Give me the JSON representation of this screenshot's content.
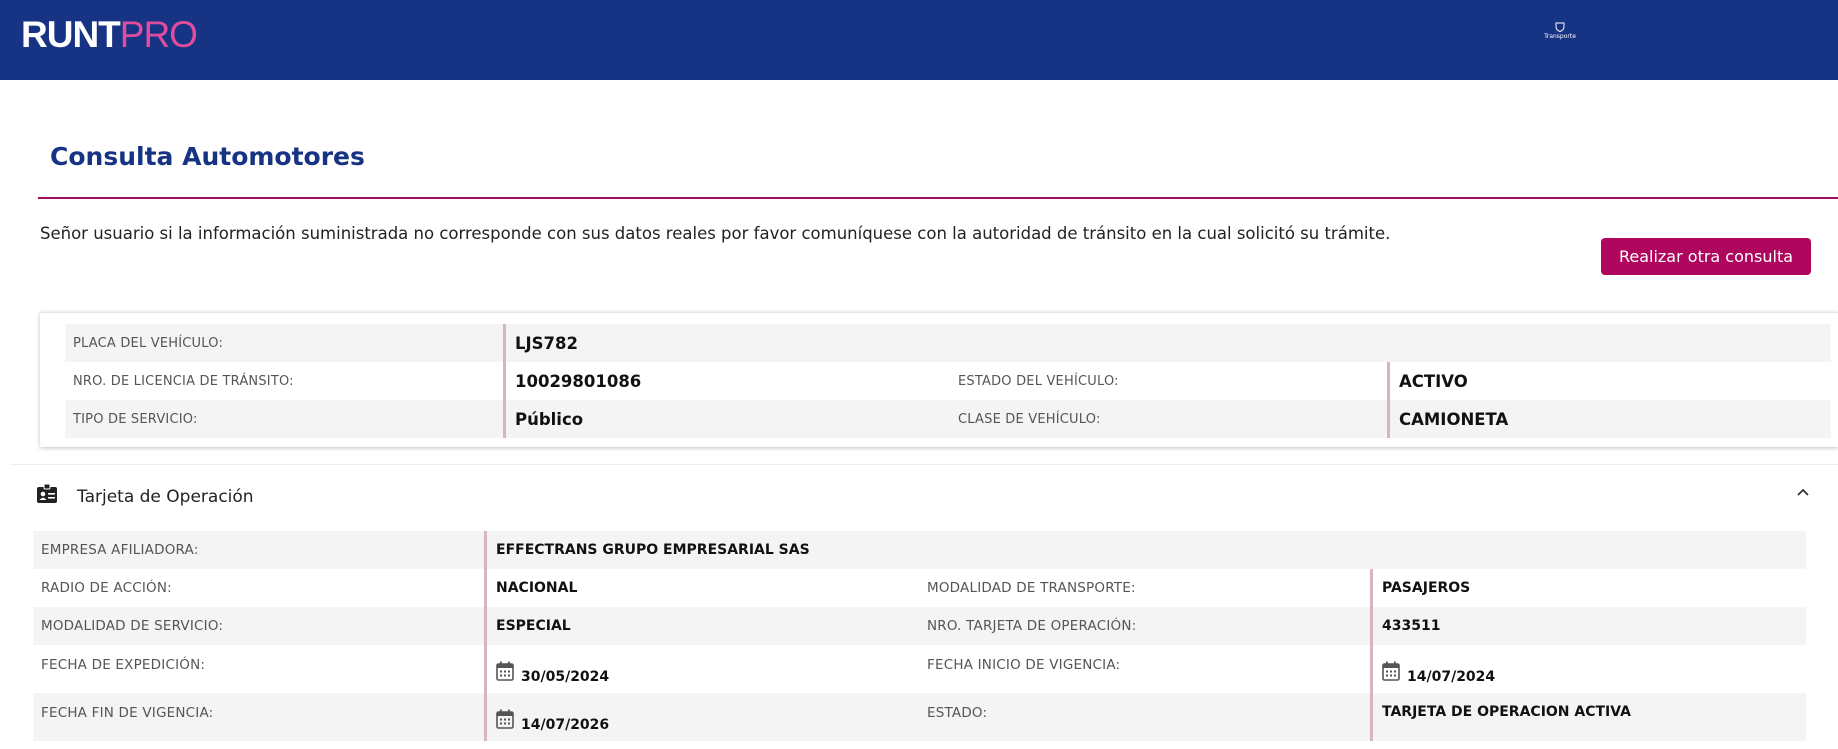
{
  "header": {
    "logo_runt": "RUNT",
    "logo_pro": "PRO",
    "ministry_label": "Transporte"
  },
  "page": {
    "title": "Consulta Automotores",
    "notice": "Señor usuario si la información suministrada no corresponde con sus datos reales por favor comuníquese con la autoridad de tránsito en la cual solicitó su trámite.",
    "new_query_button": "Realizar otra consulta"
  },
  "vehicle": {
    "plate_label": "PLACA DEL VEHÍCULO:",
    "plate_value": "LJS782",
    "license_label": "NRO. DE LICENCIA DE TRÁNSITO:",
    "license_value": "10029801086",
    "status_label": "ESTADO DEL VEHÍCULO:",
    "status_value": "ACTIVO",
    "service_label": "TIPO DE SERVICIO:",
    "service_value": "Público",
    "class_label": "CLASE DE VEHÍCULO:",
    "class_value": "CAMIONETA"
  },
  "operation_card": {
    "title": "Tarjeta de Operación",
    "company_label": "EMPRESA AFILIADORA:",
    "company_value": "EFFECTRANS GRUPO EMPRESARIAL SAS",
    "radius_label": "RADIO DE ACCIÓN:",
    "radius_value": "NACIONAL",
    "transport_mode_label": "MODALIDAD DE TRANSPORTE:",
    "transport_mode_value": "PASAJEROS",
    "service_mode_label": "MODALIDAD DE SERVICIO:",
    "service_mode_value": "ESPECIAL",
    "card_number_label": "NRO. TARJETA DE OPERACIÓN:",
    "card_number_value": "433511",
    "issue_date_label": "FECHA DE EXPEDICIÓN:",
    "issue_date_value": "30/05/2024",
    "valid_from_label": "FECHA INICIO DE VIGENCIA:",
    "valid_from_value": "14/07/2024",
    "valid_to_label": "FECHA FIN DE VIGENCIA:",
    "valid_to_value": "14/07/2026",
    "state_label": "ESTADO:",
    "state_value": "TARJETA DE OPERACION ACTIVA"
  },
  "colors": {
    "header_bg": "#173384",
    "accent": "#b0075e",
    "title": "#173384"
  }
}
